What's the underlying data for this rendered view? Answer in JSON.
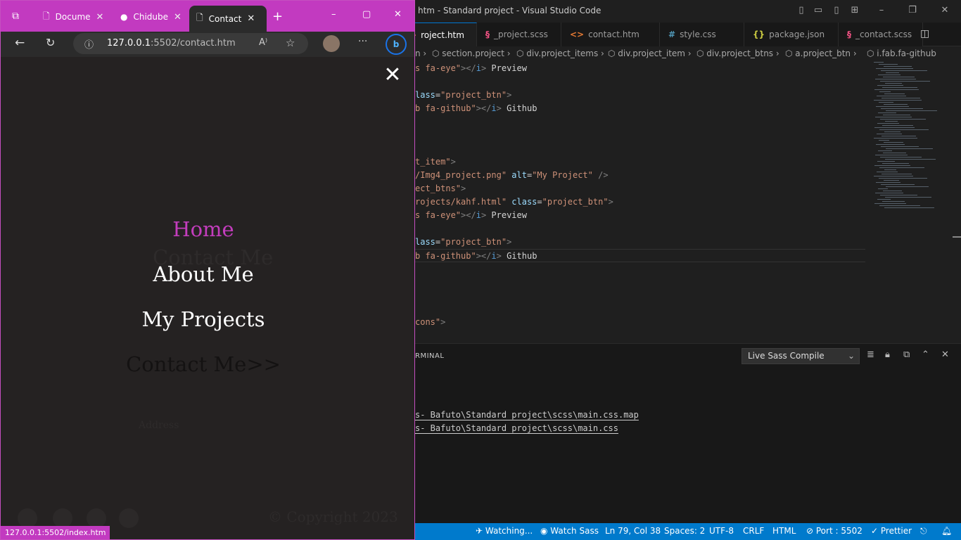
{
  "vscode": {
    "title": "htm - Standard project - Visual Studio Code",
    "tabs": [
      {
        "label": "roject.htm",
        "icon": "<>",
        "icon_color": "#e37933",
        "active": true
      },
      {
        "label": "_project.scss",
        "icon": "§",
        "icon_color": "#f55385"
      },
      {
        "label": "contact.htm",
        "icon": "<>",
        "icon_color": "#e37933"
      },
      {
        "label": "style.css",
        "icon": "#",
        "icon_color": "#519aba"
      },
      {
        "label": "package.json",
        "icon": "{}",
        "icon_color": "#cbcb41"
      },
      {
        "label": "_contact.scss",
        "icon": "§",
        "icon_color": "#f55385"
      }
    ],
    "breadcrumb": [
      "n",
      "section.project",
      "div.project_items",
      "div.project_item",
      "div.project_btns",
      "a.project_btn",
      "i.fab.fa-github"
    ],
    "code": [
      {
        "tokens": [
          {
            "t": "s fa-eye\"",
            "c": "st"
          },
          {
            "t": "></",
            "c": "tag"
          },
          {
            "t": "i",
            "c": "kw"
          },
          {
            "t": "> ",
            "c": "tag"
          },
          {
            "t": "Preview",
            "c": "tx"
          }
        ]
      },
      {
        "tokens": []
      },
      {
        "tokens": [
          {
            "t": "lass",
            "c": "at"
          },
          {
            "t": "=",
            "c": "tx"
          },
          {
            "t": "\"project_btn\"",
            "c": "st"
          },
          {
            "t": ">",
            "c": "tag"
          }
        ]
      },
      {
        "tokens": [
          {
            "t": "b fa-github\"",
            "c": "st"
          },
          {
            "t": "></",
            "c": "tag"
          },
          {
            "t": "i",
            "c": "kw"
          },
          {
            "t": "> ",
            "c": "tag"
          },
          {
            "t": "Github",
            "c": "tx"
          }
        ]
      },
      {
        "tokens": []
      },
      {
        "tokens": []
      },
      {
        "tokens": []
      },
      {
        "tokens": [
          {
            "t": "t_item\"",
            "c": "st"
          },
          {
            "t": ">",
            "c": "tag"
          }
        ]
      },
      {
        "tokens": [
          {
            "t": "/Img4_project.png\"",
            "c": "st"
          },
          {
            "t": " alt",
            "c": "at"
          },
          {
            "t": "=",
            "c": "tx"
          },
          {
            "t": "\"My Project\"",
            "c": "st"
          },
          {
            "t": " />",
            "c": "tag"
          }
        ]
      },
      {
        "tokens": [
          {
            "t": "ect_btns\"",
            "c": "st"
          },
          {
            "t": ">",
            "c": "tag"
          }
        ]
      },
      {
        "tokens": [
          {
            "t": "rojects/kahf.html\"",
            "c": "st"
          },
          {
            "t": " class",
            "c": "at"
          },
          {
            "t": "=",
            "c": "tx"
          },
          {
            "t": "\"project_btn\"",
            "c": "st"
          },
          {
            "t": ">",
            "c": "tag"
          }
        ]
      },
      {
        "tokens": [
          {
            "t": "s fa-eye\"",
            "c": "st"
          },
          {
            "t": "></",
            "c": "tag"
          },
          {
            "t": "i",
            "c": "kw"
          },
          {
            "t": "> ",
            "c": "tag"
          },
          {
            "t": "Preview",
            "c": "tx"
          }
        ]
      },
      {
        "tokens": []
      },
      {
        "tokens": [
          {
            "t": "lass",
            "c": "at"
          },
          {
            "t": "=",
            "c": "tx"
          },
          {
            "t": "\"project_btn\"",
            "c": "st"
          },
          {
            "t": ">",
            "c": "tag"
          }
        ]
      },
      {
        "tokens": [
          {
            "t": "b fa-github\"",
            "c": "st"
          },
          {
            "t": "></",
            "c": "tag"
          },
          {
            "t": "i",
            "c": "kw"
          },
          {
            "t": "> ",
            "c": "tag"
          },
          {
            "t": "Github",
            "c": "tx"
          }
        ],
        "current": true
      },
      {
        "tokens": []
      },
      {
        "tokens": []
      },
      {
        "tokens": []
      },
      {
        "tokens": []
      },
      {
        "tokens": [
          {
            "t": "cons\"",
            "c": "st"
          },
          {
            "t": ">",
            "c": "tag"
          }
        ]
      }
    ],
    "panel": {
      "tab": "RMINAL",
      "dropdown": "Live Sass Compile",
      "lines": [
        "s- Bafuto\\Standard project\\scss\\main.css.map",
        "s- Bafuto\\Standard project\\scss\\main.css"
      ]
    },
    "status": {
      "watching": "Watching...",
      "watch_sass": "Watch Sass",
      "position": "Ln 79, Col 38",
      "spaces": "Spaces: 2",
      "encoding": "UTF-8",
      "eol": "CRLF",
      "language": "HTML",
      "port": "Port : 5502",
      "prettier": "Prettier"
    }
  },
  "browser": {
    "accent": "#c23ac0",
    "tabs": [
      {
        "label": "Docume",
        "icon": "document-icon"
      },
      {
        "label": "Chidube",
        "icon": "github-icon"
      },
      {
        "label": "Contact",
        "icon": "document-icon",
        "active": true
      }
    ],
    "url_host": "127.0.0.1",
    "url_path": ":5502/contact.htm",
    "nav_links": [
      {
        "label": "Home",
        "color": "#c33dbd"
      },
      {
        "label": "About Me",
        "color": "#ffffff"
      },
      {
        "label": "My Projects",
        "color": "#ffffff"
      },
      {
        "label": "Contact Me>>",
        "color": "#141212"
      }
    ],
    "ghost_contact": "Contact Me",
    "ghost_address": "Address",
    "ghost_copyright": "© Copyright 2023",
    "status_url": "127.0.0.1:5502/index.htm"
  }
}
